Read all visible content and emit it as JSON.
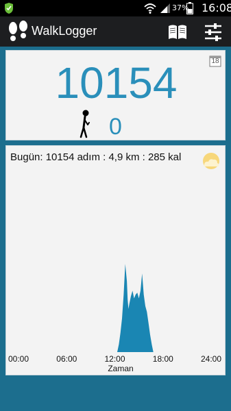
{
  "status_bar": {
    "battery_percent": "37%",
    "time": "16:08",
    "icons": [
      "notification-icon",
      "wifi-icon",
      "signal-icon",
      "battery-icon"
    ]
  },
  "action_bar": {
    "title": "WalkLogger",
    "icons": [
      "footprints-icon",
      "book-icon",
      "settings-sliders-icon"
    ]
  },
  "counter": {
    "steps": "10154",
    "calendar_day": "18",
    "secondary_value": "0"
  },
  "graph": {
    "summary": "Bugün: 10154 adım : 4,9 km : 285 kal",
    "weather_icon": "weather-sun-cloud-icon"
  },
  "colors": {
    "background": "#1c6e8e",
    "accent": "#2a8fba",
    "chart_fill": "#1a86b3",
    "action_bar": "#1d1e20"
  },
  "chart_data": {
    "type": "area",
    "x_ticks": [
      "00:00",
      "06:00",
      "12:00",
      "18:00",
      "24:00"
    ],
    "xlabel": "Zaman",
    "ylabel": "",
    "x_range": [
      0,
      24
    ],
    "y_range": [
      0,
      100
    ],
    "grid": false,
    "series": [
      {
        "x": [
          0,
          12.3,
          12.5,
          12.7,
          12.9,
          13.1,
          13.3,
          13.5,
          13.6,
          13.7,
          13.8,
          14.0,
          14.2,
          14.4,
          14.6,
          14.8,
          15.0,
          15.2,
          15.4,
          15.6,
          15.8,
          16.0,
          16.2,
          16.4,
          16.6,
          16.8,
          24
        ],
        "y": [
          0,
          0,
          8,
          20,
          35,
          60,
          92,
          74,
          55,
          45,
          50,
          58,
          64,
          56,
          60,
          62,
          56,
          64,
          82,
          60,
          48,
          42,
          30,
          18,
          8,
          0,
          0
        ]
      }
    ]
  }
}
